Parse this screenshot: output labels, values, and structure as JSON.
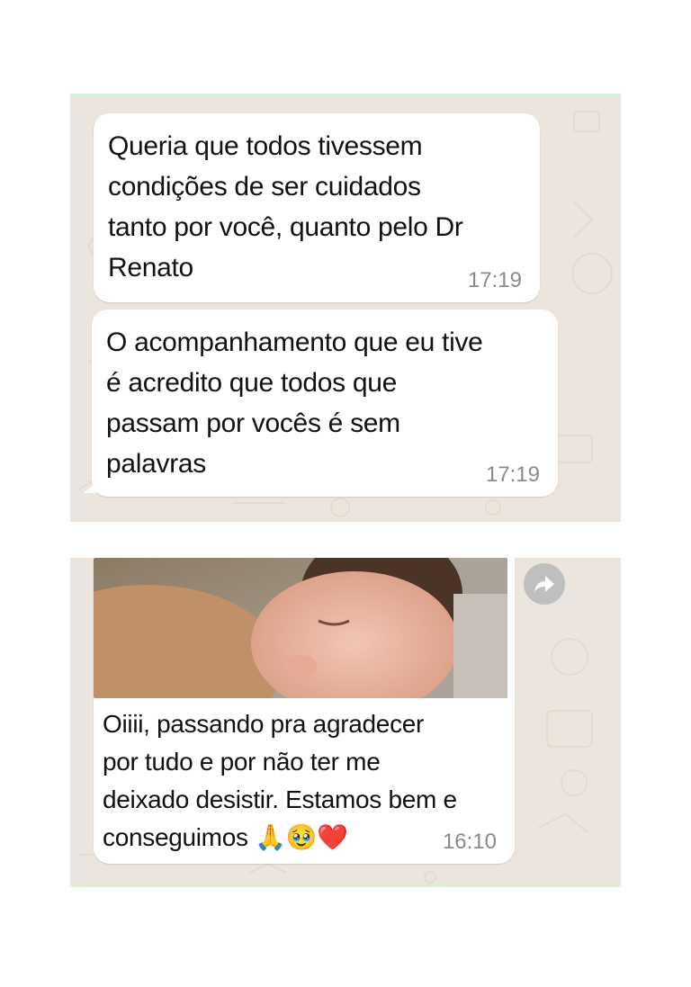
{
  "screenshot_1": {
    "messages": [
      {
        "text": "Queria que todos tivessem\ncondições de ser cuidados\ntanto por você, quanto pelo Dr\nRenato",
        "time": "17:19"
      },
      {
        "text": "O acompanhamento que eu tive\né acredito que todos que\npassam por vocês é sem\npalavras",
        "time": "17:19"
      }
    ]
  },
  "screenshot_2": {
    "message": {
      "text": "Oiiii, passando pra agradecer\npor tudo e por não ter me\ndeixado desistir. Estamos bem e\nconseguimos 🙏🥹❤️",
      "time": "16:10"
    },
    "photo_icon": "sleeping-baby-photo",
    "forward_icon": "forward-icon"
  },
  "colors": {
    "chat_background": "#ece5dd",
    "bubble": "#ffffff",
    "time_text": "#8a8a8a"
  }
}
